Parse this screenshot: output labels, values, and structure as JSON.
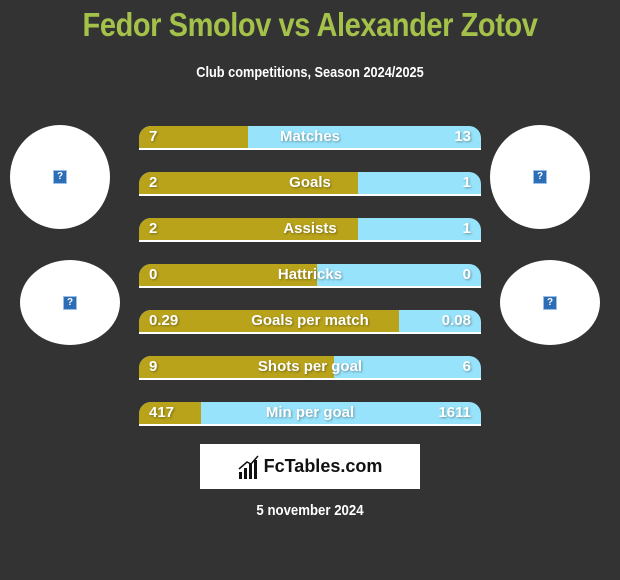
{
  "header": {
    "title": "Fedor Smolov vs Alexander Zotov",
    "subtitle": "Club competitions, Season 2024/2025"
  },
  "colors": {
    "background": "#333333",
    "title": "#a4c24a",
    "left_player": "#b9a31b",
    "right_player": "#97e3fb"
  },
  "players": {
    "left": {
      "name": "Fedor Smolov",
      "logo_icon": "missing-image-icon",
      "club_icon": "missing-image-icon"
    },
    "right": {
      "name": "Alexander Zotov",
      "logo_icon": "missing-image-icon",
      "club_icon": "missing-image-icon"
    }
  },
  "stats": [
    {
      "label": "Matches",
      "left": "7",
      "right": "13",
      "left_share": 0.32
    },
    {
      "label": "Goals",
      "left": "2",
      "right": "1",
      "left_share": 0.64
    },
    {
      "label": "Assists",
      "left": "2",
      "right": "1",
      "left_share": 0.64
    },
    {
      "label": "Hattricks",
      "left": "0",
      "right": "0",
      "left_share": 0.52
    },
    {
      "label": "Goals per match",
      "left": "0.29",
      "right": "0.08",
      "left_share": 0.76
    },
    {
      "label": "Shots per goal",
      "left": "9",
      "right": "6",
      "left_share": 0.57
    },
    {
      "label": "Min per goal",
      "left": "417",
      "right": "1611",
      "left_share": 0.18
    }
  ],
  "brand": {
    "name": "FcTables.com",
    "icon": "bar-chart-icon"
  },
  "footer": {
    "date": "5 november 2024"
  }
}
